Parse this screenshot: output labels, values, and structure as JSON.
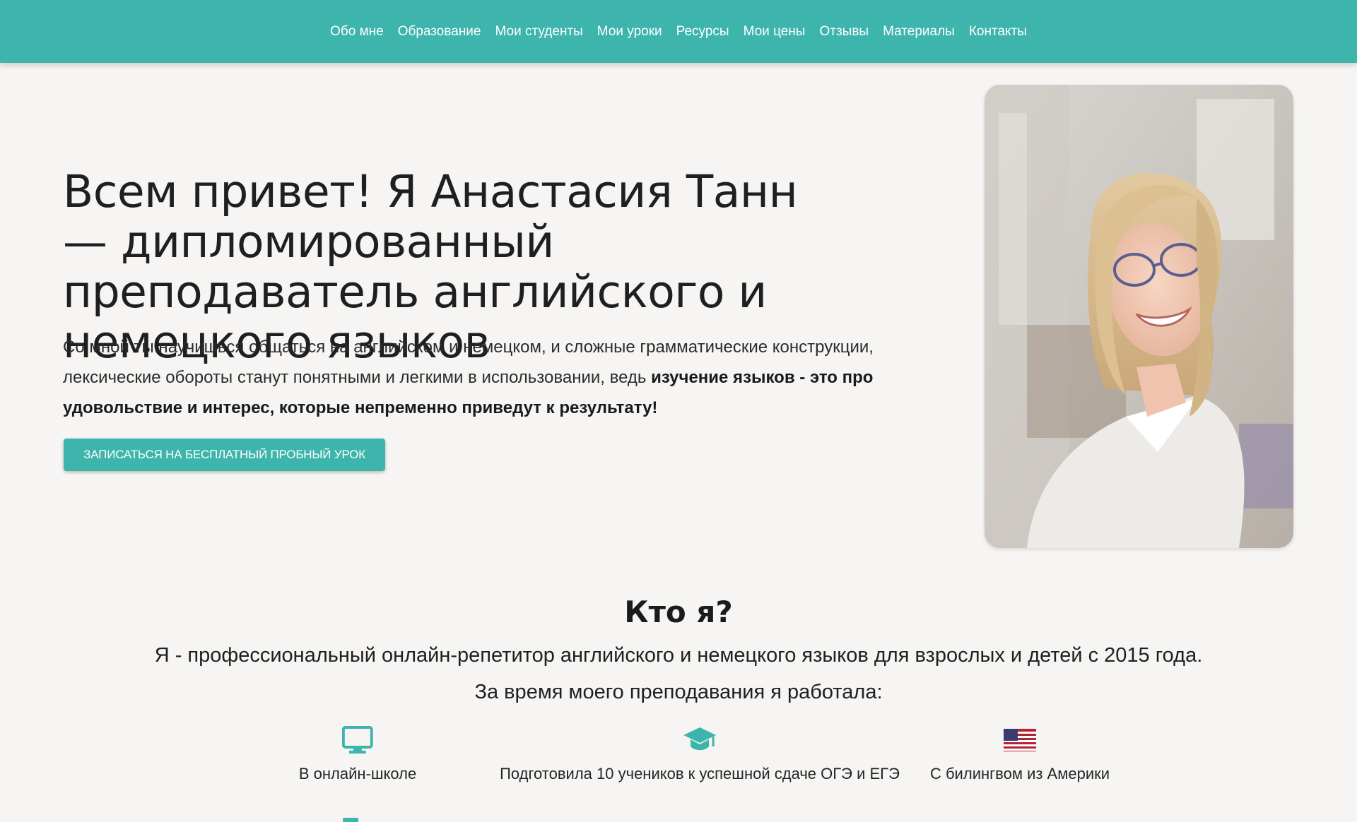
{
  "nav": {
    "items": [
      {
        "label": "Обо мне"
      },
      {
        "label": "Образование"
      },
      {
        "label": "Мои студенты"
      },
      {
        "label": "Мои уроки"
      },
      {
        "label": "Ресурсы"
      },
      {
        "label": "Мои цены"
      },
      {
        "label": "Отзывы"
      },
      {
        "label": "Материалы"
      },
      {
        "label": "Контакты"
      }
    ]
  },
  "hero": {
    "title": "Всем привет! Я Анастасия Танн — дипломированный преподаватель английского и немецкого языков",
    "text_regular": "Со мной ты научишься общаться на английском и немецком, и сложные грамматические конструкции, лексические обороты станут понятными и легкими в использовании, ведь ",
    "text_bold": "изучение языков - это про удовольствие и интерес, которые непременно приведут к результату!",
    "cta_label": "Записаться на бесплатный пробный урок"
  },
  "about": {
    "title": "Кто я?",
    "line1": "Я - профессиональный онлайн-репетитор английского и немецкого языков для взрослых и детей с 2015 года.",
    "line2": "За время моего преподавания я работала:",
    "features": [
      {
        "icon": "monitor-icon",
        "label": "В онлайн-школе"
      },
      {
        "icon": "graduation-cap-icon",
        "label": "Подготовила 10 учеников к успешной сдаче ОГЭ и ЕГЭ"
      },
      {
        "icon": "us-flag-icon",
        "label": "С билингвом из Америки"
      }
    ]
  },
  "colors": {
    "accent": "#3db5ad",
    "background": "#f6f5f3",
    "text": "#1e1e1e"
  }
}
